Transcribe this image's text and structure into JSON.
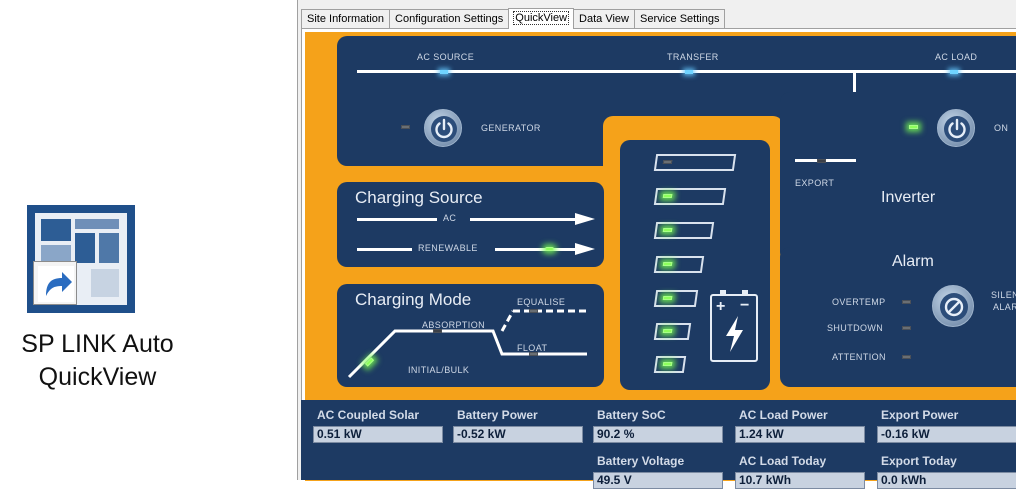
{
  "desktop": {
    "shortcut_label_line1": "SP LINK Auto",
    "shortcut_label_line2": "QuickView"
  },
  "tabs": [
    {
      "label": "Site Information",
      "active": false
    },
    {
      "label": "Configuration Settings",
      "active": false
    },
    {
      "label": "QuickView",
      "active": true
    },
    {
      "label": "Data View",
      "active": false
    },
    {
      "label": "Service Settings",
      "active": false
    }
  ],
  "top_bus": {
    "ac_source": "AC SOURCE",
    "transfer": "TRANSFER",
    "ac_load": "AC LOAD",
    "generator": "GENERATOR",
    "export": "EXPORT",
    "inverter": "Inverter",
    "inverter_state": "ON"
  },
  "charging_source": {
    "title": "Charging Source",
    "ac": "AC",
    "renewable": "RENEWABLE"
  },
  "charging_mode": {
    "title": "Charging Mode",
    "equalise": "EQUALISE",
    "absorption": "ABSORPTION",
    "float": "FLOAT",
    "initial_bulk": "INITIAL/BULK"
  },
  "alarm": {
    "title": "Alarm",
    "overtemp": "OVERTEMP",
    "shutdown": "SHUTDOWN",
    "attention": "ATTENTION",
    "silence": "SILEN",
    "silence2": "ALAR"
  },
  "battery_symbol": {
    "plus": "+",
    "minus": "−"
  },
  "data": {
    "ac_coupled_solar": {
      "label": "AC Coupled Solar",
      "value": "0.51 kW"
    },
    "battery_power": {
      "label": "Battery Power",
      "value": "-0.52 kW"
    },
    "battery_soc": {
      "label": "Battery SoC",
      "value": "90.2 %"
    },
    "ac_load_power": {
      "label": "AC Load Power",
      "value": "1.24 kW"
    },
    "export_power": {
      "label": "Export Power",
      "value": "-0.16 kW"
    },
    "battery_voltage": {
      "label": "Battery Voltage",
      "value": "49.5 V"
    },
    "ac_load_today": {
      "label": "AC Load Today",
      "value": "10.7 kWh"
    },
    "export_today": {
      "label": "Export Today",
      "value": "0.0 kWh"
    }
  },
  "colors": {
    "panel_orange": "#f5a21a",
    "panel_navy": "#1d3a63",
    "led_green": "#8cff5a"
  }
}
